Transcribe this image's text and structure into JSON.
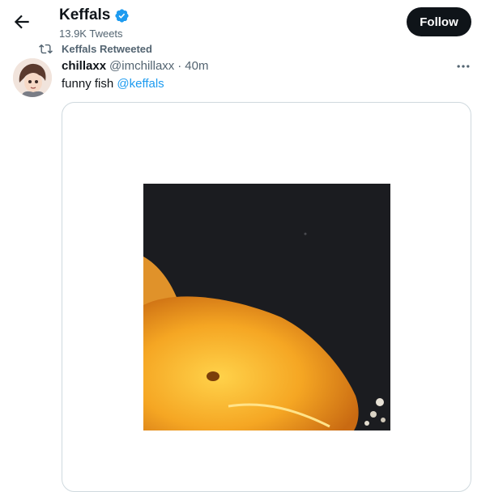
{
  "header": {
    "back_icon": "arrow-left-icon",
    "title": "Keffals",
    "verified_icon": "verified-badge-icon",
    "tweet_count": "13.9K Tweets",
    "follow_label": "Follow"
  },
  "retweet": {
    "icon": "retweet-icon",
    "label": "Keffals Retweeted"
  },
  "tweet": {
    "author_name": "chillaxx",
    "handle": "@imchillaxx",
    "separator": "·",
    "time": "40m",
    "text": "funny fish ",
    "mention": "@keffals",
    "more_icon": "more-options-icon",
    "media": "video of goldfish"
  },
  "colors": {
    "accent": "#1d9bf0",
    "follow_bg": "#0f1419",
    "muted": "#536471",
    "border": "#cfd9de"
  }
}
